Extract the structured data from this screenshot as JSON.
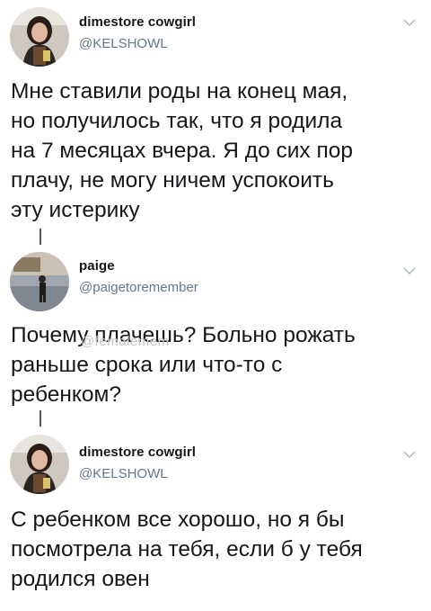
{
  "tweets": [
    {
      "name": "dimestore cowgirl",
      "handle": "@KELSHOWL",
      "text_lines": [
        "Мне ставили роды на конец мая,",
        "но получилось так, что я родила",
        "на 7 месяцах вчера. Я до сих пор",
        "плачу, не могу ничем успокоить",
        "эту истерику"
      ]
    },
    {
      "name": "paige",
      "handle": "@paigetoremember",
      "text_lines": [
        "Почему плачешь? Больно рожать",
        "раньше срока или что-то с",
        "ребенком?"
      ]
    },
    {
      "name": "dimestore cowgirl",
      "handle": "@KELSHOWL",
      "text_lines": [
        "С ребенком все хорошо, но я бы",
        "посмотрела на тебя, если б у тебя",
        "родился овен"
      ]
    }
  ],
  "watermark": "@femalemem",
  "icons": [
    "chevron-down-icon",
    "avatar"
  ]
}
